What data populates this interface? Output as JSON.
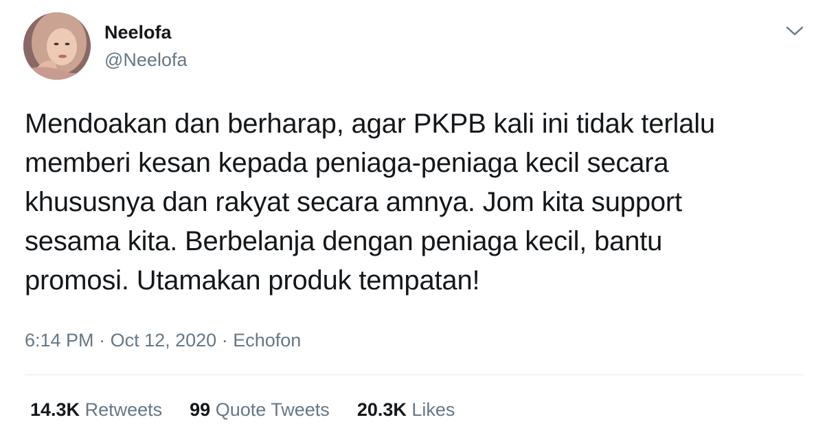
{
  "author": {
    "display_name": "Neelofa",
    "handle": "@Neelofa"
  },
  "tweet": {
    "text": "Mendoakan dan berharap, agar PKPB kali ini tidak terlalu\nmemberi kesan kepada peniaga-peniaga kecil secara\nkhususnya dan rakyat secara amnya. Jom kita support\nsesama kita. Berbelanja dengan peniaga kecil, bantu\npromosi. Utamakan produk tempatan!",
    "time": "6:14 PM",
    "date": "Oct 12, 2020",
    "source": "Echofon",
    "separator": "·"
  },
  "stats": {
    "retweets_count": "14.3K",
    "retweets_label": "Retweets",
    "quotes_count": "99",
    "quotes_label": "Quote Tweets",
    "likes_count": "20.3K",
    "likes_label": "Likes"
  },
  "icons": {
    "menu": "chevron-down-icon"
  },
  "colors": {
    "text_primary": "#14171a",
    "text_secondary": "#657786",
    "divider": "#e1e8ed",
    "background": "#ffffff"
  }
}
